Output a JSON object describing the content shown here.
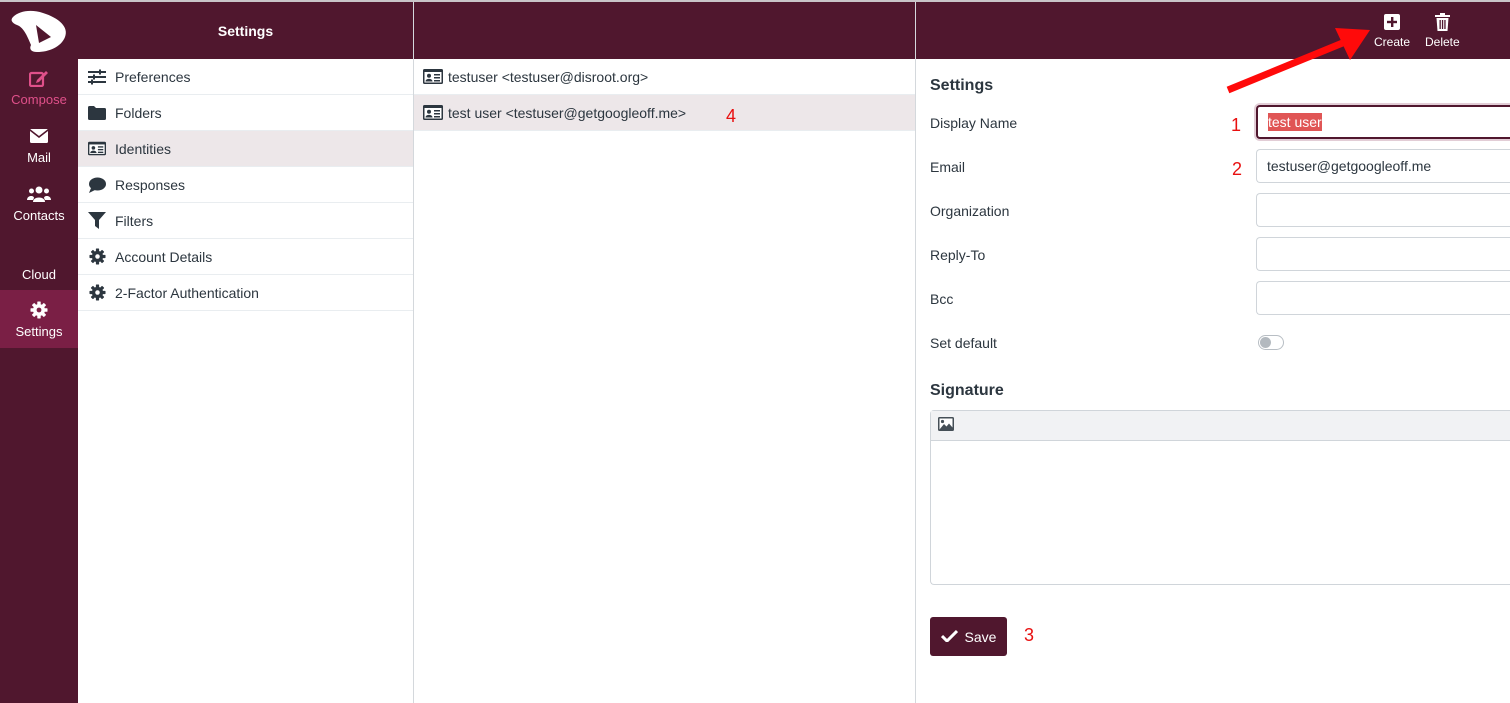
{
  "app_nav": {
    "items": [
      {
        "id": "compose",
        "label": "Compose",
        "icon": "compose-icon"
      },
      {
        "id": "mail",
        "label": "Mail",
        "icon": "envelope-icon"
      },
      {
        "id": "contacts",
        "label": "Contacts",
        "icon": "users-icon"
      },
      {
        "id": "cloud",
        "label": "Cloud",
        "icon": ""
      },
      {
        "id": "settings",
        "label": "Settings",
        "icon": "gear-icon",
        "active": true
      }
    ]
  },
  "settings_panel": {
    "title": "Settings",
    "items": [
      {
        "label": "Preferences",
        "icon": "sliders-icon"
      },
      {
        "label": "Folders",
        "icon": "folder-icon"
      },
      {
        "label": "Identities",
        "icon": "id-card-icon",
        "selected": true
      },
      {
        "label": "Responses",
        "icon": "comment-icon"
      },
      {
        "label": "Filters",
        "icon": "filter-icon"
      },
      {
        "label": "Account Details",
        "icon": "gear-icon"
      },
      {
        "label": "2-Factor Authentication",
        "icon": "gear-icon"
      }
    ]
  },
  "identities": {
    "items": [
      {
        "label": "testuser <testuser@disroot.org>",
        "icon": "id-card-icon"
      },
      {
        "label": "test user <testuser@getgoogleoff.me>",
        "icon": "id-card-icon",
        "selected": true
      }
    ]
  },
  "toolbar": {
    "create_label": "Create",
    "delete_label": "Delete"
  },
  "identity_form": {
    "section_title": "Settings",
    "fields": {
      "display_name": {
        "label": "Display Name",
        "value": "test user"
      },
      "email": {
        "label": "Email",
        "value": "testuser@getgoogleoff.me"
      },
      "organization": {
        "label": "Organization",
        "value": ""
      },
      "reply_to": {
        "label": "Reply-To",
        "value": ""
      },
      "bcc": {
        "label": "Bcc",
        "value": ""
      },
      "set_default": {
        "label": "Set default",
        "value": false
      }
    },
    "signature_title": "Signature",
    "signature_value": "",
    "save_label": "Save"
  },
  "annotations": {
    "n1": "1",
    "n2": "2",
    "n3": "3",
    "n4": "4",
    "color": "#e81010"
  },
  "colors": {
    "brand": "#50172e",
    "active_nav": "#7a1f45",
    "compose_accent": "#e0508a",
    "selection_bg": "#ede7e9"
  }
}
